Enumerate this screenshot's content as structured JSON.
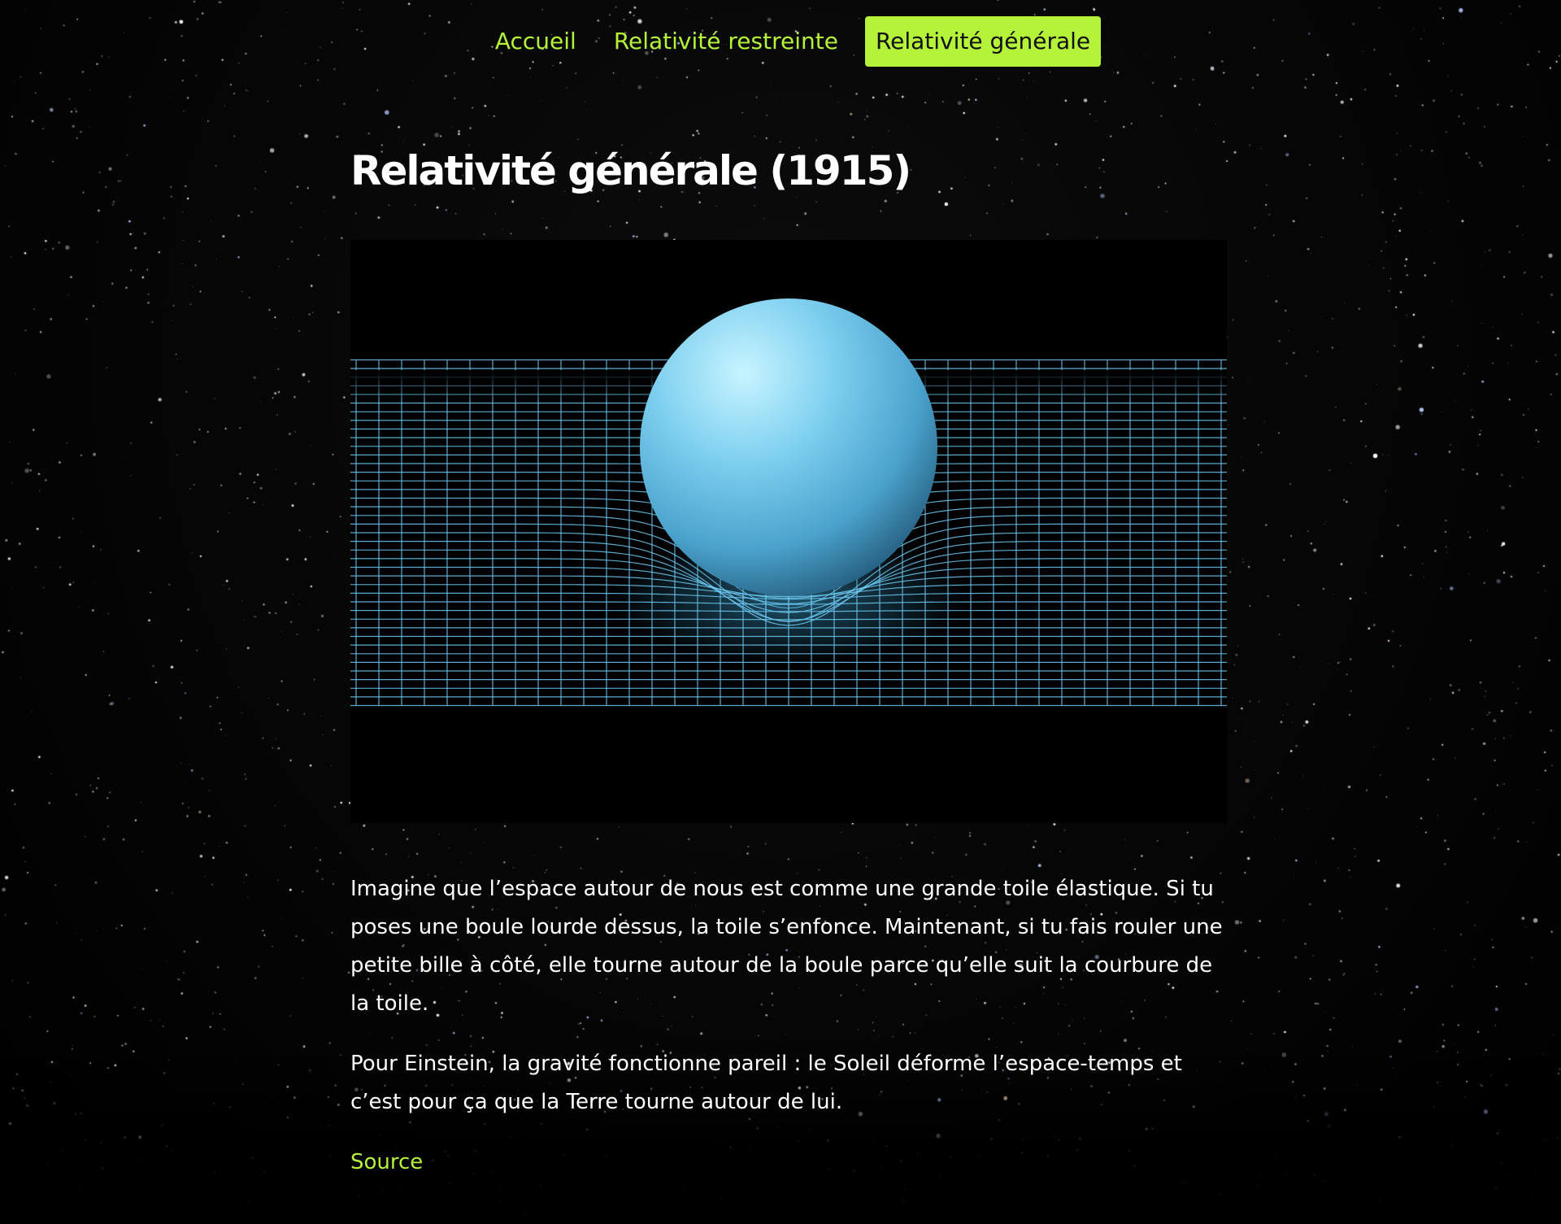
{
  "nav": {
    "items": [
      {
        "label": "Accueil",
        "active": false
      },
      {
        "label": "Relativité restreinte",
        "active": false
      },
      {
        "label": "Relativité générale",
        "active": true
      }
    ]
  },
  "main": {
    "title": "Relativité générale (1915)",
    "paragraphs": [
      "Imagine que l’espace autour de nous est comme une grande toile élastique. Si tu poses une boule lourde dessus, la toile s’enfonce. Maintenant, si tu fais rouler une petite bille à côté, elle tourne autour de la boule parce qu’elle suit la courbure de la toile.",
      "Pour Einstein, la gravité fonctionne pareil : le Soleil déforme l’espace-temps et c’est pour ça que la Terre tourne autour de lui."
    ],
    "source_label": "Source"
  },
  "colors": {
    "accent": "#b5f23a",
    "background": "#000000",
    "text": "#ffffff",
    "sphere": "#5fb8e0",
    "grid": "#6cc8f0"
  },
  "illustration": {
    "subject": "sphere-on-curved-spacetime-grid"
  }
}
